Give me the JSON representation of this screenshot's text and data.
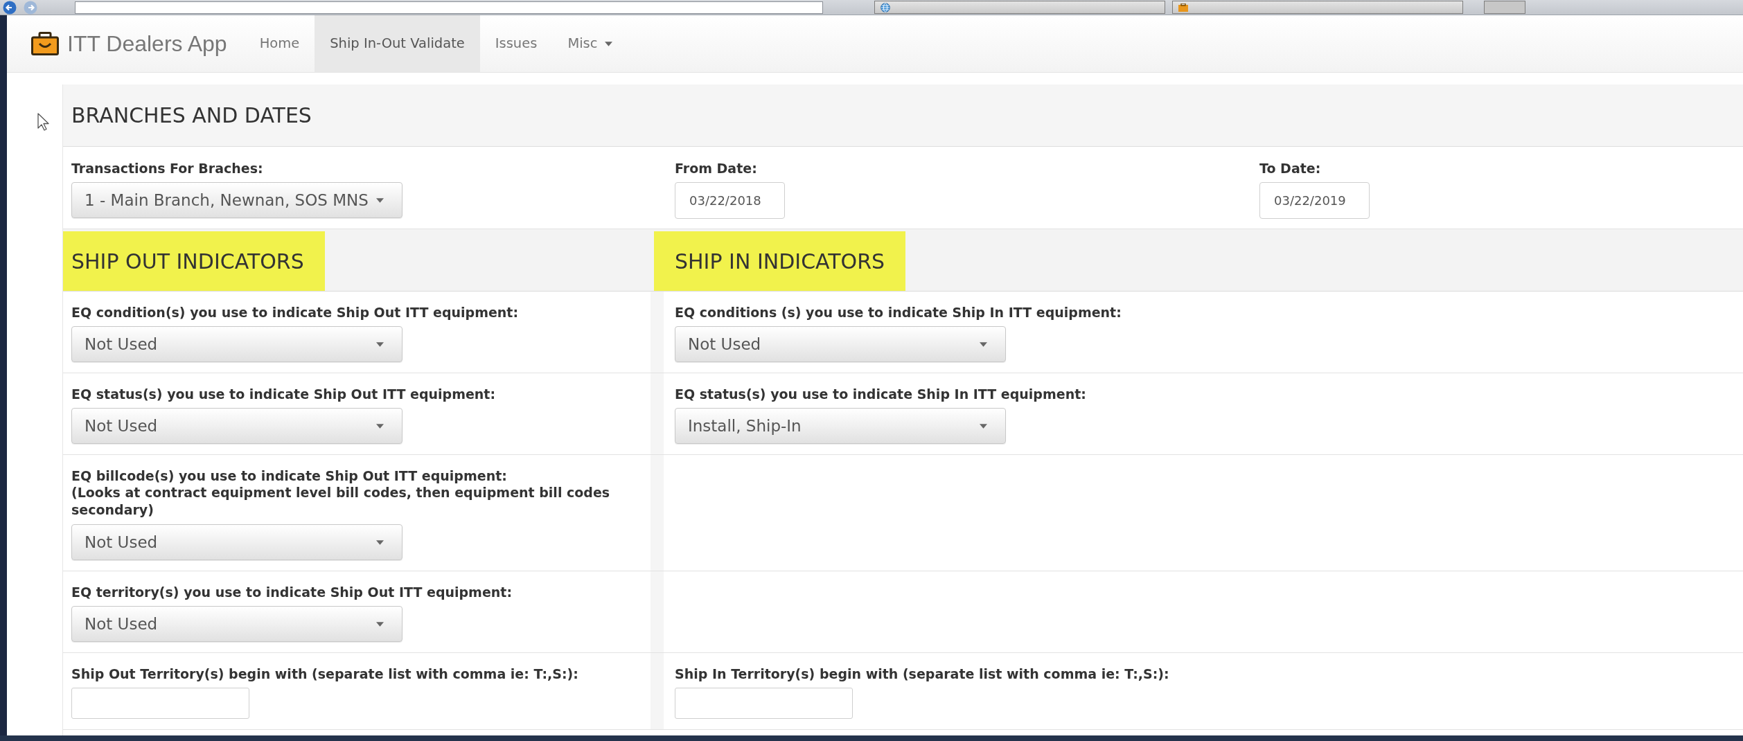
{
  "navbar": {
    "brand": "ITT Dealers App",
    "items": [
      {
        "label": "Home",
        "kind": "link",
        "selected": false
      },
      {
        "label": "Ship In-Out Validate",
        "kind": "link",
        "selected": true
      },
      {
        "label": "Issues",
        "kind": "link",
        "selected": false
      },
      {
        "label": "Misc",
        "kind": "dropdown",
        "selected": false
      }
    ]
  },
  "branches_panel": {
    "title": "BRANCHES AND DATES",
    "fields": [
      {
        "label": "Transactions For Braches:",
        "kind": "select",
        "value": "1 - Main Branch, Newnan, SOS MNS"
      },
      {
        "label": "From Date:",
        "kind": "date",
        "value": "03/22/2018"
      },
      {
        "label": "To Date:",
        "kind": "date",
        "value": "03/22/2019"
      }
    ]
  },
  "indicator_sections": [
    {
      "title": "SHIP OUT INDICATORS",
      "highlighted": true
    },
    {
      "title": "SHIP IN INDICATORS",
      "highlighted": true
    }
  ],
  "indicator_rows": [
    {
      "ship_out": {
        "label": "EQ condition(s) you use to indicate Ship Out ITT equipment:",
        "kind": "select",
        "value": "Not Used"
      },
      "ship_in": {
        "label": "EQ conditions (s) you use to indicate Ship In ITT equipment:",
        "kind": "select",
        "value": "Not Used"
      }
    },
    {
      "ship_out": {
        "label": "EQ status(s) you use to indicate Ship Out ITT equipment:",
        "kind": "select",
        "value": "Not Used"
      },
      "ship_in": {
        "label": "EQ status(s) you use to indicate Ship In ITT equipment:",
        "kind": "select",
        "value": "Install, Ship-In"
      }
    },
    {
      "ship_out": {
        "label": "EQ billcode(s) you use to indicate Ship Out ITT equipment:",
        "note": "(Looks at contract equipment level bill codes, then equipment bill codes secondary)",
        "kind": "select",
        "value": "Not Used"
      }
    },
    {
      "ship_out": {
        "label": "EQ territory(s) you use to indicate Ship Out ITT equipment:",
        "kind": "select",
        "value": "Not Used"
      }
    },
    {
      "ship_out": {
        "label": "Ship Out Territory(s) begin with (separate list with comma ie: T:,S:):",
        "kind": "text"
      },
      "ship_in": {
        "label": "Ship In Territory(s) begin with (separate list with comma ie: T:,S:):",
        "kind": "text"
      }
    }
  ]
}
